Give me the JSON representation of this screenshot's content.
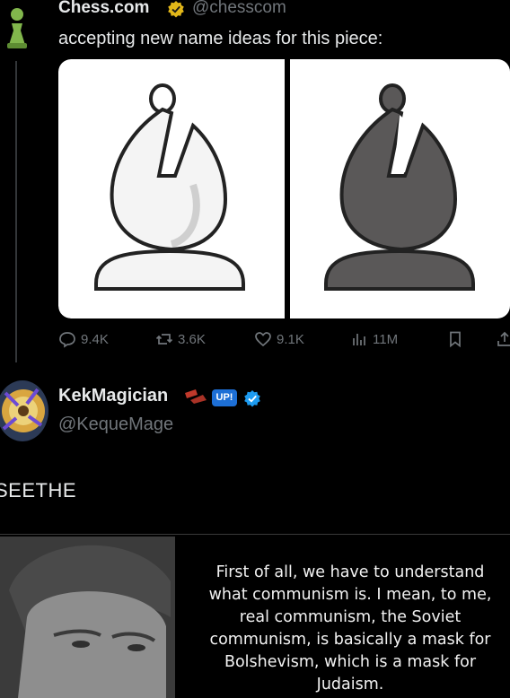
{
  "tweet": {
    "display_name": "Chess.com",
    "handle": "@chesscom",
    "text": "accepting new name ideas for this piece:",
    "verified_badge_color": "#e2b719",
    "actions": {
      "replies": "9.4K",
      "reposts": "3.6K",
      "likes": "9.1K",
      "views": "11M"
    },
    "media": {
      "left_piece": "white-bishop",
      "right_piece": "black-bishop"
    }
  },
  "reply": {
    "display_name": "KekMagician",
    "handle": "@KequeMage",
    "badge_label": "UP!",
    "text": "SEETHE",
    "quote_image_text": "First of all, we have to understand what communism is. I mean, to me, real communism, the Soviet communism, is basically a mask for Bolshevism, which is a mask for Judaism."
  },
  "colors": {
    "background": "#000000",
    "text": "#e7e9ea",
    "muted": "#71767b",
    "blue_check": "#1d9bf0",
    "pawn_green": "#81b64c"
  }
}
